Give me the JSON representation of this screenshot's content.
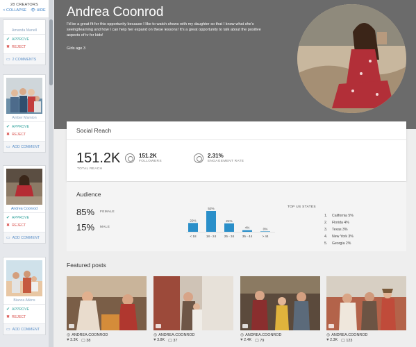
{
  "sidebar": {
    "count": "28 CREATORS",
    "collapse": "< COLLAPSE",
    "hide": "HIDE",
    "creators": [
      {
        "name": "Amanda Manell",
        "approve": "APPROVE",
        "reject": "REJECT",
        "comment": "2 COMMENTS"
      },
      {
        "name": "Amber Mamion",
        "approve": "APPROVE",
        "reject": "REJECT",
        "comment": "ADD COMMENT"
      },
      {
        "name": "Andrea Coonrod",
        "approve": "APPROVE",
        "reject": "REJECT",
        "comment": "ADD COMMENT"
      },
      {
        "name": "Bianca Atkins",
        "approve": "APPROVE",
        "reject": "REJECT",
        "comment": "ADD COMMENT"
      }
    ]
  },
  "header": {
    "name": "Andrea Coonrod",
    "bio": "I'd be a great fit for this opportunity because I like to watch shows with my daughter so that I know what she's seeing/learning and how I can help her expand on these lessons! It's a great opportunity to talk about the positive aspects of tv for kids!",
    "kids": "Girls age 3"
  },
  "social_reach": {
    "title": "Social Reach",
    "total": "151.2K",
    "total_label": "TOTAL REACH",
    "followers": "151.2K",
    "followers_label": "FOLLOWERS",
    "engagement": "2.31%",
    "engagement_label": "ENGAGEMENT RATE"
  },
  "audience": {
    "title": "Audience",
    "female_pct": "85%",
    "female_label": "FEMALE",
    "male_pct": "15%",
    "male_label": "MALE",
    "top_states_title": "TOP US STATES",
    "states": [
      {
        "num": "1.",
        "label": "California 5%"
      },
      {
        "num": "2.",
        "label": "Florida 4%"
      },
      {
        "num": "3.",
        "label": "Texas 3%"
      },
      {
        "num": "4.",
        "label": "New York 3%"
      },
      {
        "num": "5.",
        "label": "Georgia 2%"
      }
    ]
  },
  "chart_data": {
    "type": "bar",
    "categories": [
      "< 18",
      "18 - 24",
      "25 - 34",
      "35 - 44",
      "> 44"
    ],
    "values": [
      22,
      52,
      21,
      4,
      0
    ],
    "labels": [
      "22%",
      "52%",
      "21%",
      "4%",
      "0%"
    ],
    "color": "#2a8fc9",
    "ylim": [
      0,
      52
    ]
  },
  "featured": {
    "title": "Featured posts",
    "posts": [
      {
        "handle": "ANDREA.COONROD",
        "likes": "3.3K",
        "comments": "38"
      },
      {
        "handle": "ANDREA.COONROD",
        "likes": "3.8K",
        "comments": "37"
      },
      {
        "handle": "ANDREA.COONROD",
        "likes": "2.4K",
        "comments": "79"
      },
      {
        "handle": "ANDREA.COONROD",
        "likes": "2.3K",
        "comments": "123"
      }
    ]
  }
}
